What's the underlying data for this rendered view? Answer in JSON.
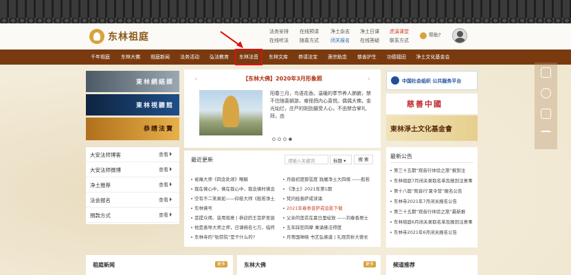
{
  "header": {
    "logo_text": "东林祖庭",
    "links_col1": [
      "法务安排",
      "在线听法"
    ],
    "links_col2": [
      "在线预请",
      "随喜方式"
    ],
    "links_col3": [
      "净土杂志",
      "闭关报名"
    ],
    "links_col4": [
      "净土日课",
      "在线答疑"
    ],
    "links_col5": [
      "虎溪课堂",
      "联系方式"
    ],
    "help_label": "帮助?"
  },
  "nav": {
    "items": [
      "千年祖庭",
      "东林大佛",
      "祖庭新闻",
      "法务活动",
      "弘法教育",
      "东林法音",
      "东林文库",
      "恭请法宝",
      "莲宗助念",
      "慈善护生",
      "功德福田",
      "净土文化基金会"
    ]
  },
  "left_tiles": [
    {
      "label": "東林網絡課"
    },
    {
      "label": "東林視聽館"
    },
    {
      "label": "恭請法寶"
    }
  ],
  "left_list": [
    {
      "label": "大安法师博客",
      "action": "查看"
    },
    {
      "label": "大安法师微博",
      "action": "查看"
    },
    {
      "label": "净土推荐",
      "action": "查看"
    },
    {
      "label": "法会报名",
      "action": "查看"
    },
    {
      "label": "捐款方式",
      "action": "查看"
    }
  ],
  "featured": {
    "title": "【东林大佛】2020年3月形象照",
    "prev": "‹",
    "next": "›",
    "text": "阳春三月，鸟语花香。温暖的季节养人肺腑，禁不住随喜朝游，难怪鸽内心喜悦。偶偶大佛，金光灿烂，庄严的刚劲摄受人心，不由禁合掌礼拜，由"
  },
  "right_banners": {
    "banner1": "中国社会组织 公共服务平台",
    "banner2": "慈善中國",
    "banner3": "東林淨土文化基金會"
  },
  "updates": {
    "title": "最近更新",
    "search_placeholder": "请输入关键词",
    "select_value": "标题",
    "search_btn": "搜 索",
    "left_items": [
      "省庵大师《四念处颂》略解",
      "我在佛心中，佛在我心中，我念佛时佛念",
      "空有不二笑真如——仰慈大师《般若净土",
      "东林佛号",
      "菩提众偈、皆用翁意 | 恭迎药王菩萨圣诞",
      "他是善导大师之师，日课佛名七万，临终",
      "东林寺的“劬劳院”是干什么的?"
    ],
    "right_items": [
      "月眉初度那弦度 践履净土大四缘 ——般若",
      "《净土》2021年第1期",
      "梵问经善萨戒读诵",
      "2021年春季普萨戒会影下载",
      "父亲的莲花在夏日里绽放 ——刘春香居士",
      "五年踩狂四摩 乘诵佛法得度",
      "月青国禅唤 书艺弘佛道 | 礼观赏析大德长"
    ]
  },
  "announcements": {
    "title": "最新公告",
    "items": [
      "第三十五期“观音行体验之旅”报到注",
      "东林祖庭7月闭关录取名单及报到注意事",
      "第十八届“观音行'夏令营”报名公告",
      "东林寺2021年7月闭关报名公告",
      "第三十五期“观音行体验之旅”最新报",
      "东林祖庭6月闭关录取名单及报到注意事",
      "东林寺2021年6月闭关报名公告"
    ]
  },
  "bottom": {
    "box1": "祖庭新闻",
    "box2": "东林大佛",
    "box3": "频道推荐",
    "more": "更多"
  }
}
